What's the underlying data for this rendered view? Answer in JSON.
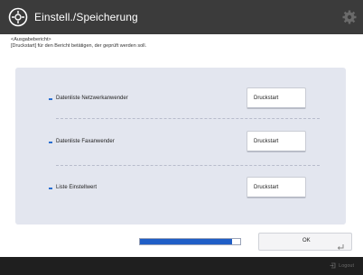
{
  "header": {
    "title": "Einstell./Speicherung",
    "app_icon": "settings-register-icon",
    "gear_icon": "gear-icon"
  },
  "notice": {
    "line1": "<Ausgabebericht>",
    "line2": "[Druckstart] für den Bericht betätigen, der geprüft werden soll."
  },
  "reports": [
    {
      "label": "Datenliste Netzwerkanwender",
      "button": "Druckstart"
    },
    {
      "label": "Datenliste Faxanwender",
      "button": "Druckstart"
    },
    {
      "label": "Liste Einstellwert",
      "button": "Druckstart"
    }
  ],
  "progress": {
    "value": 0.92,
    "color": "#1f5ec6"
  },
  "ok_button": {
    "label": "OK"
  },
  "footer": {
    "logout_label": "Logout",
    "logout_icon": "logout-icon"
  },
  "colors": {
    "header_bg": "#3b3b3b",
    "panel_bg": "#e3e6ef",
    "accent": "#2a6fd0",
    "footer_bg": "#1f1f1f"
  }
}
